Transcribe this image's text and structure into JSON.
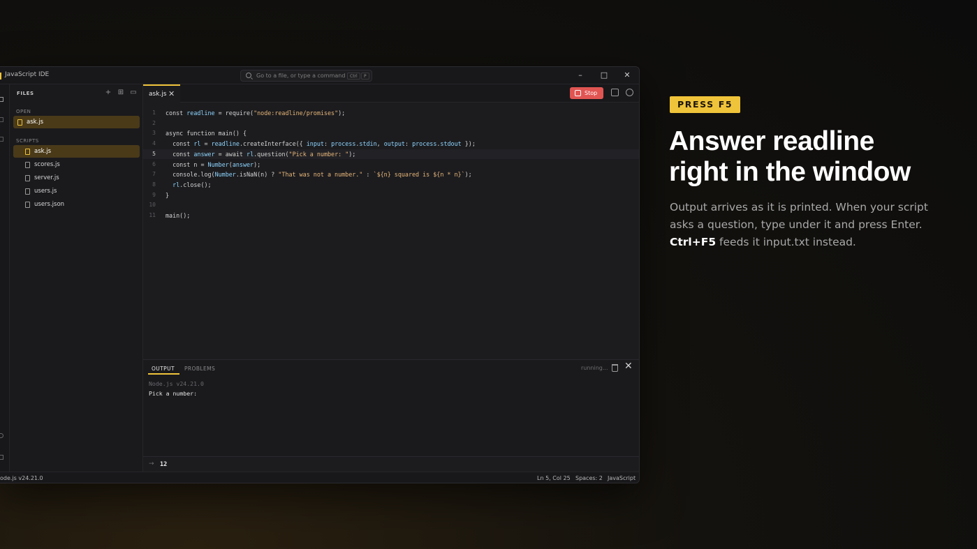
{
  "window": {
    "title": "JavaScript IDE",
    "command_placeholder": "Go to a file, or type a command",
    "shortcut_keys": [
      "Ctrl",
      "P"
    ],
    "minimize_glyph": "–",
    "maximize_glyph": "□",
    "close_glyph": "✕"
  },
  "sidebar": {
    "header": "FILES",
    "tool_icons": [
      "new-file-icon",
      "new-folder-icon",
      "folder-icon"
    ],
    "open_label": "OPEN",
    "open_files": [
      {
        "name": "ask.js",
        "active": true
      }
    ],
    "scripts_label": "SCRIPTS",
    "scripts": [
      {
        "name": "ask.js",
        "active": true
      },
      {
        "name": "scores.js",
        "active": false
      },
      {
        "name": "server.js",
        "active": false
      },
      {
        "name": "users.js",
        "active": false
      },
      {
        "name": "users.json",
        "active": false
      }
    ]
  },
  "tabs": [
    {
      "label": "ask.js",
      "close_glyph": "✕"
    }
  ],
  "toolbar": {
    "stop_label": "Stop"
  },
  "editor": {
    "current_line": 5,
    "lines": [
      "const readline = require(\"node:readline/promises\");",
      "",
      "async function main() {",
      "  const rl = readline.createInterface({ input: process.stdin, output: process.stdout });",
      "  const answer = await rl.question(\"Pick a number: \");",
      "  const n = Number(answer);",
      "  console.log(Number.isNaN(n) ? \"That was not a number.\" : `${n} squared is ${n * n}`);",
      "  rl.close();",
      "}",
      "",
      "main();"
    ]
  },
  "panel": {
    "tabs": [
      "OUTPUT",
      "PROBLEMS"
    ],
    "status": "running...",
    "close_glyph": "✕",
    "output_lines": [
      {
        "text": "Node.js v24.21.0",
        "dim": true
      },
      {
        "text": "Pick a number:",
        "dim": false
      }
    ],
    "input_arrow": "→",
    "input_value": "12"
  },
  "statusbar": {
    "left": "ode.js v24.21.0",
    "cursor": "Ln 5, Col 25",
    "spaces": "Spaces: 2",
    "language": "JavaScript"
  },
  "promo": {
    "badge": "PRESS F5",
    "headline_line1": "Answer readline",
    "headline_line2": "right in the window",
    "desc_part1": "Output arrives as it is printed. When your script asks a question, type under it and press Enter.",
    "desc_key": "Ctrl+F5",
    "desc_part2": "feeds it input.txt instead."
  },
  "colors": {
    "accent": "#f0c43a",
    "stop": "#e05552",
    "keyword": "#d4d4d4",
    "string": "#e8b77a",
    "property": "#8fd6ff"
  }
}
